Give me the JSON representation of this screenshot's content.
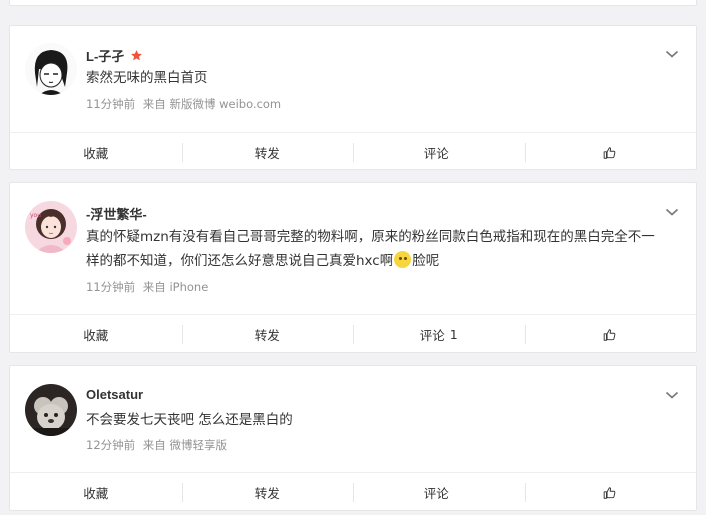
{
  "posts": [
    {
      "username": "L-子孑",
      "text": "索然无味的黑白首页",
      "time": "11分钟前",
      "source": "来自 新版微博 weibo.com",
      "actions": {
        "favorite": "收藏",
        "repost": "转发",
        "comment": "评论",
        "comment_count": ""
      }
    },
    {
      "username": "-浮世繁华-",
      "text_before": "真的怀疑mzn有没有看自己哥哥完整的物料啊，原来的粉丝同款白色戒指和现在的黑白完全不一样的都不知道，你们还怎么好意思说自己真爱hxc啊",
      "text_after": "脸呢",
      "time": "11分钟前",
      "source": "来自 iPhone",
      "actions": {
        "favorite": "收藏",
        "repost": "转发",
        "comment": "评论",
        "comment_count": "1"
      }
    },
    {
      "username": "Oletsatur",
      "text": "不会要发七天丧吧 怎么还是黑白的",
      "time": "12分钟前",
      "source": "来自 微博轻享版",
      "actions": {
        "favorite": "收藏",
        "repost": "转发",
        "comment": "评论",
        "comment_count": ""
      }
    }
  ],
  "icons": {
    "expand": "chevron-down-icon",
    "like": "thumbs-up-icon",
    "vip_badge": "star-badge-icon",
    "emoji": "emoji-icon"
  },
  "colors": {
    "badge": "#f0523a",
    "meta": "#939393",
    "background": "#f2f2f5"
  }
}
